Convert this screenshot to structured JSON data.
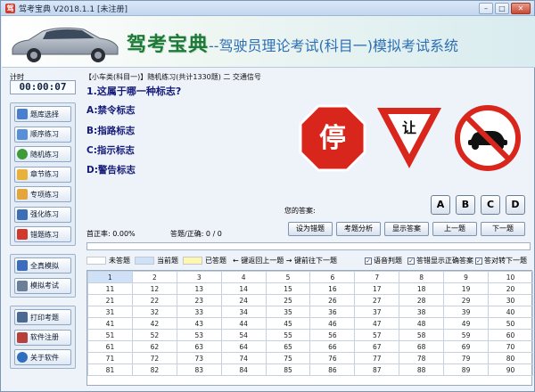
{
  "window": {
    "title": "驾考宝典 V2018.1.1 [未注册]",
    "controls": [
      "minimize",
      "maximize",
      "close"
    ]
  },
  "banner": {
    "brand": "驾考宝典",
    "subtitle": "--驾驶员理论考试(科目一)模拟考试系统"
  },
  "timer": {
    "label": "计时",
    "value": "00:00:07"
  },
  "sidebar": {
    "group1": [
      {
        "label": "题库选择",
        "icon": "people-icon",
        "color": "#4a7fd0"
      },
      {
        "label": "顺序练习",
        "icon": "chart-icon",
        "color": "#5a8fd8"
      },
      {
        "label": "随机练习",
        "icon": "refresh-icon",
        "color": "#3f9a3a"
      },
      {
        "label": "章节练习",
        "icon": "folder-icon",
        "color": "#e8b23a"
      },
      {
        "label": "专项练习",
        "icon": "note-icon",
        "color": "#e6a53a"
      },
      {
        "label": "强化练习",
        "icon": "window-icon",
        "color": "#3d6fb7"
      },
      {
        "label": "错题练习",
        "icon": "bookmark-icon",
        "color": "#d0392c"
      }
    ],
    "group2": [
      {
        "label": "全真模拟",
        "icon": "grid-icon",
        "color": "#3b6dbc"
      },
      {
        "label": "模拟考试",
        "icon": "exam-icon",
        "color": "#6b7f96"
      }
    ],
    "group3": [
      {
        "label": "打印考题",
        "icon": "print-icon",
        "color": "#4a6a92"
      },
      {
        "label": "软件注册",
        "icon": "pen-icon",
        "color": "#b8403a"
      },
      {
        "label": "关于软件",
        "icon": "info-icon",
        "color": "#2f6fc1"
      }
    ]
  },
  "breadcrumb": "【小车类(科目一)】随机练习(共计1330题) 二 交通信号",
  "question": {
    "text": "1.这属于哪一种标志?",
    "options": [
      "A:禁令标志",
      "B:指路标志",
      "C:指示标志",
      "D:警告标志"
    ]
  },
  "signs": {
    "stop": "停",
    "yield": "让"
  },
  "answer": {
    "label": "您的答案:",
    "choices": [
      "A",
      "B",
      "C",
      "D"
    ]
  },
  "stats": {
    "accuracy": "首正率: 0.00%",
    "progress": "答题/正确: 0 / 0"
  },
  "actions": [
    "设为错题",
    "考题分析",
    "显示答案",
    "上一题",
    "下一题"
  ],
  "progress": {
    "fraction": 0.0
  },
  "legend": {
    "unanswered": "未答题",
    "current": "当前题",
    "answered": "已答题",
    "nav_hint": "← 键返回上一题   → 键前往下一题",
    "check1": "语音判题",
    "check2": "答错显示正确答案",
    "check3": "答对转下一题"
  },
  "question_grid": [
    [
      "1",
      "2",
      "3",
      "4",
      "5",
      "6",
      "7",
      "8",
      "9",
      "10"
    ],
    [
      "11",
      "12",
      "13",
      "14",
      "15",
      "16",
      "17",
      "18",
      "19",
      "20"
    ],
    [
      "21",
      "22",
      "23",
      "24",
      "25",
      "26",
      "27",
      "28",
      "29",
      "30"
    ],
    [
      "31",
      "32",
      "33",
      "34",
      "35",
      "36",
      "37",
      "38",
      "39",
      "40"
    ],
    [
      "41",
      "42",
      "43",
      "44",
      "45",
      "46",
      "47",
      "48",
      "49",
      "50"
    ],
    [
      "51",
      "52",
      "53",
      "54",
      "55",
      "56",
      "57",
      "58",
      "59",
      "60"
    ],
    [
      "61",
      "62",
      "63",
      "64",
      "65",
      "66",
      "67",
      "68",
      "69",
      "70"
    ],
    [
      "71",
      "72",
      "73",
      "74",
      "75",
      "76",
      "77",
      "78",
      "79",
      "80"
    ],
    [
      "81",
      "82",
      "83",
      "84",
      "85",
      "86",
      "87",
      "88",
      "89",
      "90"
    ]
  ],
  "colors": {
    "question_text": "#141a78",
    "brand_green": "#1f7a3a",
    "current_cell": "#cfe1f7",
    "answered_cell": "#fff6b0"
  }
}
